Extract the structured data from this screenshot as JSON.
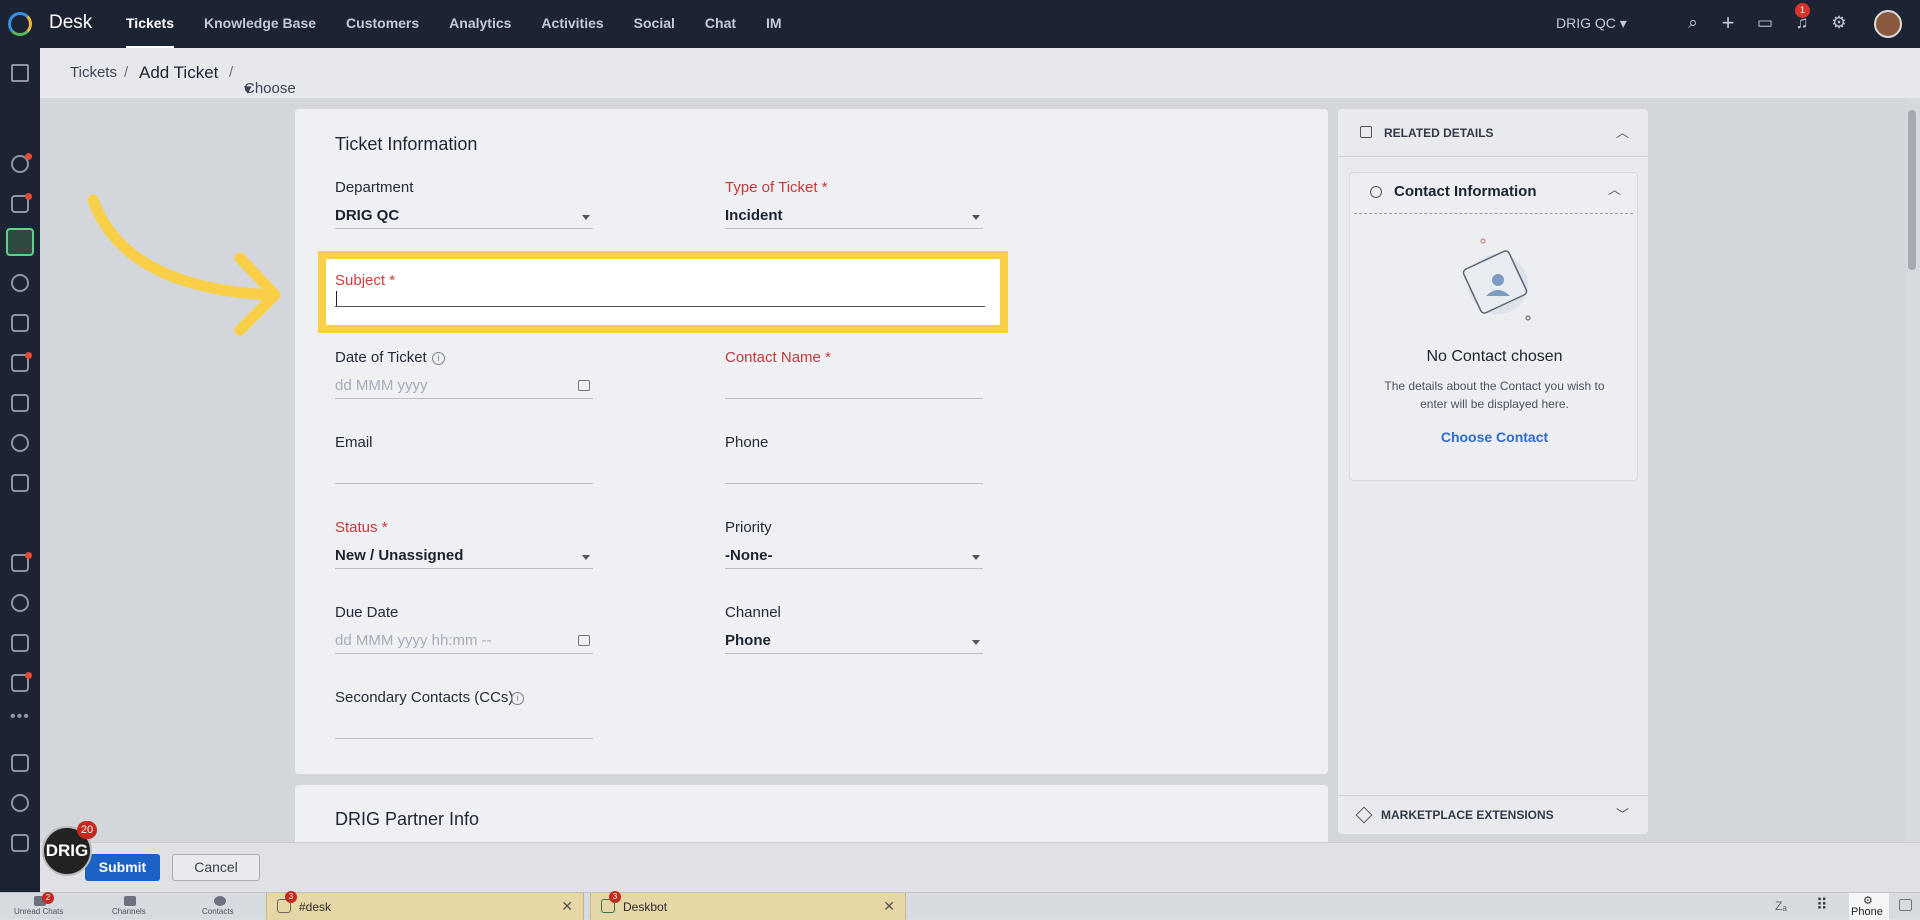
{
  "topbar": {
    "app_name": "Desk",
    "nav": [
      "Tickets",
      "Knowledge Base",
      "Customers",
      "Analytics",
      "Activities",
      "Social",
      "Chat",
      "IM"
    ],
    "active_nav": "Tickets",
    "org_name": "DRIG QC",
    "notification_count": "1"
  },
  "breadcrumb": {
    "root": "Tickets",
    "sep1": "/",
    "current": "Add Ticket",
    "sep2": "/",
    "template": "Choose Ticket Template"
  },
  "form": {
    "section_title": "Ticket Information",
    "department_label": "Department",
    "department_value": "DRIG QC",
    "type_label": "Type of Ticket *",
    "type_value": "Incident",
    "subject_label": "Subject *",
    "subject_value": "",
    "date_label": "Date of Ticket",
    "date_placeholder": "dd MMM yyyy",
    "contact_label": "Contact Name *",
    "email_label": "Email",
    "phone_label": "Phone",
    "status_label": "Status *",
    "status_value": "New / Unassigned",
    "priority_label": "Priority",
    "priority_value": "-None-",
    "due_label": "Due Date",
    "due_placeholder": "dd MMM yyyy hh:mm --",
    "channel_label": "Channel",
    "channel_value": "Phone",
    "cc_label": "Secondary Contacts (CCs)",
    "info_glyph": "i",
    "next_section_title": "DRIG Partner Info"
  },
  "right_panel": {
    "title": "RELATED DETAILS",
    "contact_title": "Contact Information",
    "no_contact": "No Contact chosen",
    "description": "The details about the Contact you wish to enter will be displayed here.",
    "choose_link": "Choose Contact",
    "marketplace": "MARKETPLACE EXTENSIONS"
  },
  "actions": {
    "submit": "Submit",
    "cancel": "Cancel"
  },
  "drig_widget": {
    "logo_text": "DRIG",
    "badge_count": "20"
  },
  "bottombar": {
    "unread_chats": "Unread Chats",
    "unread_count": "2",
    "channels": "Channels",
    "contacts": "Contacts",
    "chat_tabs": [
      {
        "label": "#desk",
        "badge": "3"
      },
      {
        "label": "Deskbot",
        "badge": "3"
      }
    ],
    "phone": "Phone"
  },
  "colors": {
    "highlight": "#f9cf47",
    "primary": "#1c62c4",
    "required": "#c6383a"
  }
}
